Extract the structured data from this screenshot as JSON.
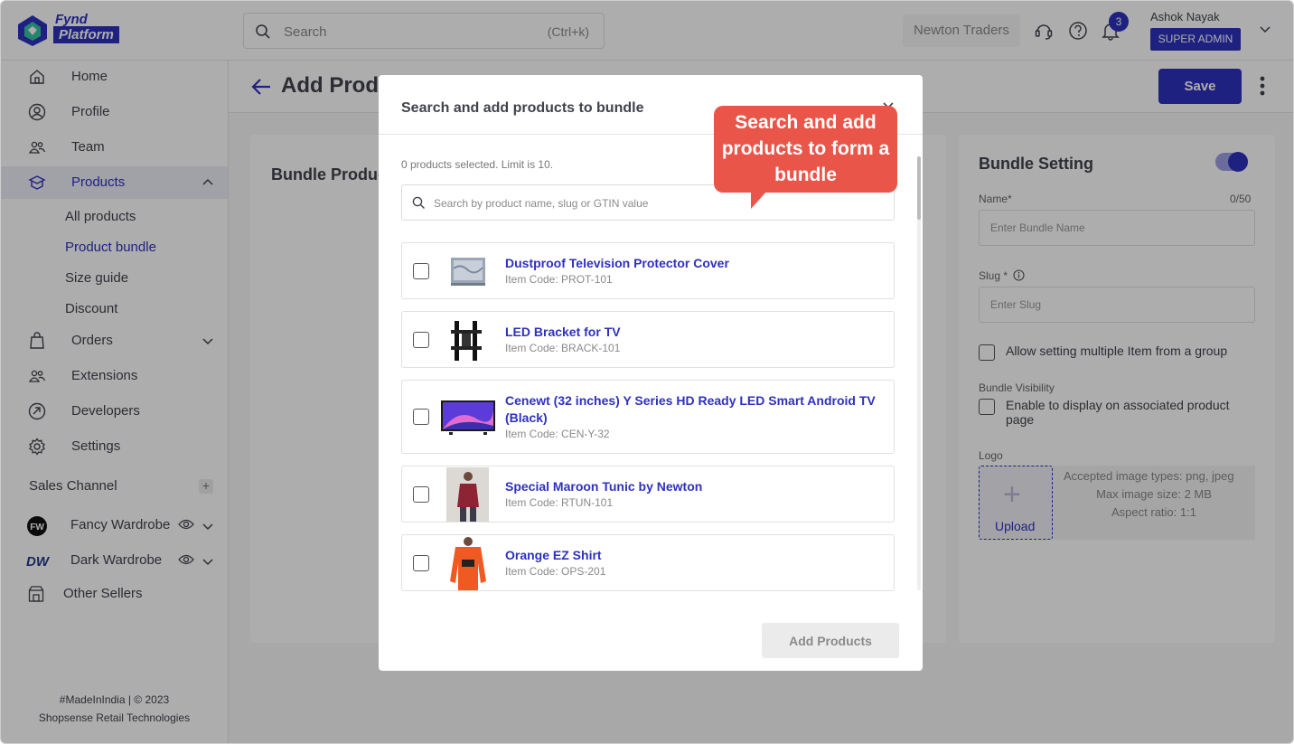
{
  "header": {
    "logo_word1": "Fynd",
    "logo_word2": "Platform",
    "search_placeholder": "Search",
    "search_shortcut": "(Ctrl+k)",
    "company": "Newton Traders",
    "notification_count": "3",
    "user_name": "Ashok Nayak",
    "user_role": "SUPER ADMIN"
  },
  "sidebar": {
    "items": [
      {
        "label": "Home",
        "icon": "home-icon"
      },
      {
        "label": "Profile",
        "icon": "user-circle-icon"
      },
      {
        "label": "Team",
        "icon": "team-icon"
      },
      {
        "label": "Products",
        "icon": "box-icon"
      }
    ],
    "product_sub": [
      "All products",
      "Product bundle",
      "Size guide",
      "Discount"
    ],
    "items2": [
      {
        "label": "Orders",
        "icon": "bag-icon"
      },
      {
        "label": "Extensions",
        "icon": "extensions-icon"
      },
      {
        "label": "Developers",
        "icon": "developers-icon"
      },
      {
        "label": "Settings",
        "icon": "gear-icon"
      }
    ],
    "sales_channel_label": "Sales Channel",
    "channels": [
      {
        "label": "Fancy Wardrobe",
        "logo": "FW"
      },
      {
        "label": "Dark Wardrobe",
        "logo": "DW"
      }
    ],
    "other_sellers": "Other Sellers",
    "footer_line1": "#MadeInIndia | © 2023",
    "footer_line2": "Shopsense Retail Technologies"
  },
  "page": {
    "title": "Add Product Bundle",
    "save_label": "Save",
    "left_card_title": "Bundle Products"
  },
  "bundle_setting": {
    "title": "Bundle Setting",
    "name_label": "Name*",
    "name_count": "0/50",
    "name_placeholder": "Enter Bundle Name",
    "slug_label": "Slug *",
    "slug_placeholder": "Enter Slug",
    "allow_multiple": "Allow setting multiple Item from a group",
    "visibility_label": "Bundle Visibility",
    "visibility_text": "Enable to display on associated product page",
    "logo_label": "Logo",
    "upload_label": "Upload",
    "upload_info": [
      "Accepted image types: png, jpeg",
      "Max image size: 2 MB",
      "Aspect ratio: 1:1"
    ]
  },
  "modal": {
    "title": "Search and add products to bundle",
    "selected_text": "0 products selected. Limit is 10.",
    "search_placeholder": "Search by product name, slug or GTIN value",
    "products": [
      {
        "name": "Dustproof Television Protector Cover",
        "code": "Item Code: PROT-101"
      },
      {
        "name": "LED Bracket for TV",
        "code": "Item Code: BRACK-101"
      },
      {
        "name": "Cenewt (32 inches) Y Series HD Ready LED Smart Android TV (Black)",
        "code": "Item Code: CEN-Y-32"
      },
      {
        "name": "Special Maroon Tunic by Newton",
        "code": "Item Code: RTUN-101"
      },
      {
        "name": "Orange EZ Shirt",
        "code": "Item Code: OPS-201"
      }
    ],
    "add_button": "Add Products"
  },
  "callout": {
    "text": "Search and add products to form a bundle"
  },
  "colors": {
    "primary": "#2e31be",
    "callout": "#ea5549"
  }
}
